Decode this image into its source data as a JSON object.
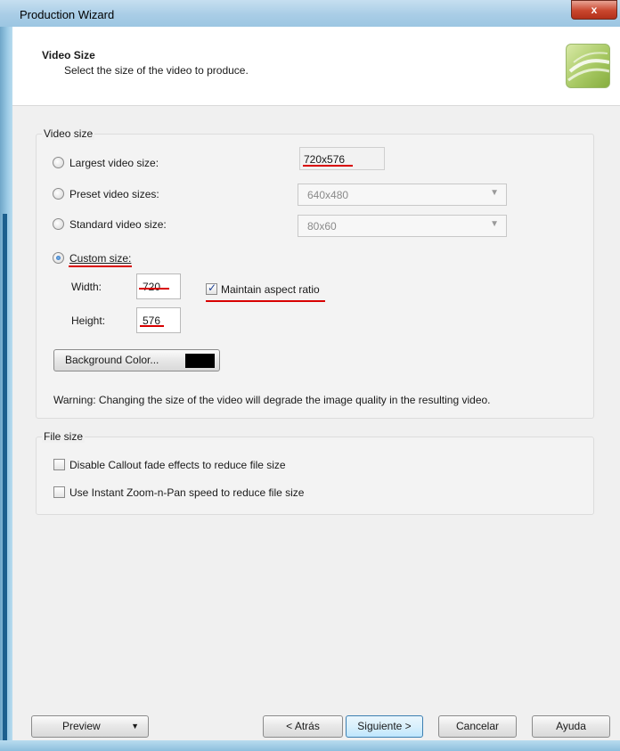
{
  "window": {
    "title": "Production Wizard",
    "close_label": "x"
  },
  "header": {
    "title": "Video Size",
    "subtitle": "Select the size of the video to produce."
  },
  "video_size_group": {
    "label": "Video size",
    "largest": {
      "label": "Largest video size:",
      "value": "720x576",
      "checked": false
    },
    "preset": {
      "label": "Preset video sizes:",
      "value": "640x480",
      "checked": false
    },
    "standard": {
      "label": "Standard video size:",
      "value": "80x60",
      "checked": false
    },
    "custom": {
      "label": "Custom size:",
      "checked": true
    },
    "width": {
      "label": "Width:",
      "value": "720"
    },
    "height": {
      "label": "Height:",
      "value": "576"
    },
    "maintain_aspect": {
      "label": "Maintain aspect ratio",
      "checked": true
    },
    "background_color_button": "Background Color...",
    "background_color": "#000000",
    "warning": "Warning: Changing the size of the video will degrade the image quality in the resulting video."
  },
  "file_size_group": {
    "label": "File size",
    "disable_callout": {
      "label": "Disable Callout fade effects to reduce file size",
      "checked": false
    },
    "instant_zoom": {
      "label": "Use Instant Zoom-n-Pan speed to reduce file size",
      "checked": false
    }
  },
  "footer": {
    "preview": "Preview",
    "back": "< Atrás",
    "next": "Siguiente >",
    "cancel": "Cancelar",
    "help": "Ayuda"
  },
  "colors": {
    "annotation_red": "#d80000",
    "accent_green": "#a8c964"
  },
  "icons": {
    "dropdown": "chevron-down-icon",
    "close": "close-icon",
    "logo": "product-logo-icon"
  }
}
